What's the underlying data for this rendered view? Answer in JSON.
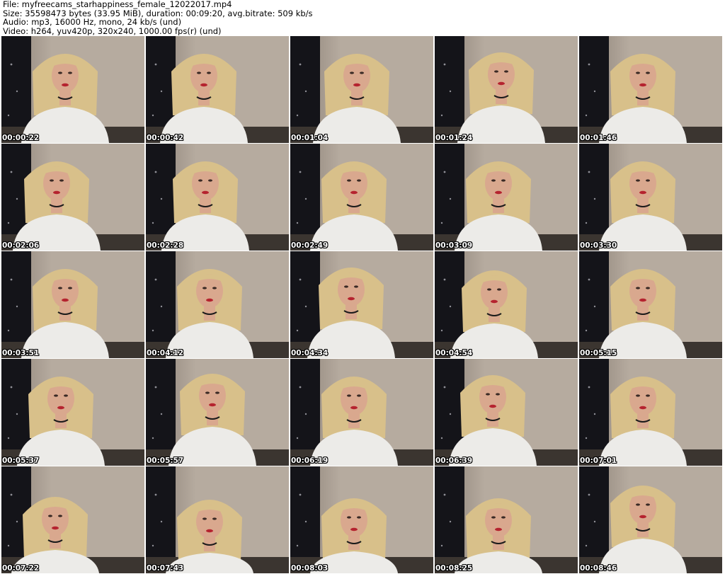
{
  "header": {
    "file_line": "File: myfreecams_starhappiness_female_12022017.mp4",
    "size_line": "Size: 35598473 bytes (33.95 MiB), duration: 00:09:20, avg.bitrate: 509 kb/s",
    "audio_line": "Audio: mp3, 16000 Hz, mono, 24 kb/s (und)",
    "video_line": "Video: h264, yuv420p, 320x240, 1000.00 fps(r) (und)"
  },
  "colors": {
    "wall": "#b6ab9f",
    "wall_shadow": "#857a70",
    "curtain": "#141419",
    "hair": "#d8c08a",
    "skin": "#d9a88e",
    "shirt": "#ecebe8",
    "lips": "#b5232f",
    "timestamp": "#ffffff"
  },
  "thumbnails": [
    {
      "time": "00:00:22"
    },
    {
      "time": "00:00:42"
    },
    {
      "time": "00:01:04"
    },
    {
      "time": "00:01:24"
    },
    {
      "time": "00:01:46"
    },
    {
      "time": "00:02:06"
    },
    {
      "time": "00:02:28"
    },
    {
      "time": "00:02:49"
    },
    {
      "time": "00:03:09"
    },
    {
      "time": "00:03:30"
    },
    {
      "time": "00:03:51"
    },
    {
      "time": "00:04:12"
    },
    {
      "time": "00:04:34"
    },
    {
      "time": "00:04:54"
    },
    {
      "time": "00:05:15"
    },
    {
      "time": "00:05:37"
    },
    {
      "time": "00:05:57"
    },
    {
      "time": "00:06:19"
    },
    {
      "time": "00:06:39"
    },
    {
      "time": "00:07:01"
    },
    {
      "time": "00:07:22"
    },
    {
      "time": "00:07:43"
    },
    {
      "time": "00:08:03"
    },
    {
      "time": "00:08:25"
    },
    {
      "time": "00:08:46"
    }
  ]
}
